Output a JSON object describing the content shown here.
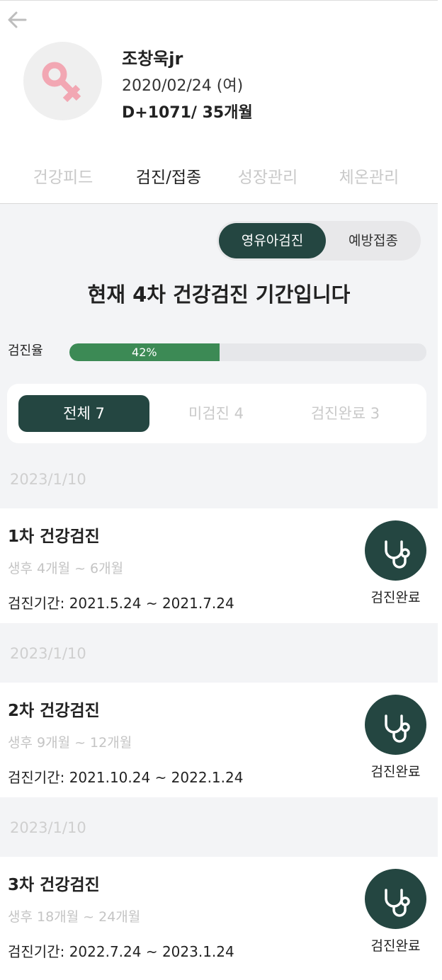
{
  "profile": {
    "name": "조창욱jr",
    "birth": "2020/02/24 (여)",
    "dday": "D+1071/ 35개월",
    "avatar_icon": "female-symbol-icon",
    "avatar_color": "#f2a7b3"
  },
  "tabs": [
    {
      "label": "건강피드",
      "active": false
    },
    {
      "label": "검진/접종",
      "active": true
    },
    {
      "label": "성장관리",
      "active": false
    },
    {
      "label": "체온관리",
      "active": false
    }
  ],
  "segment": {
    "options": [
      "영유아검진",
      "예방접종"
    ],
    "selected": "영유아검진"
  },
  "period_title": "현재 4차 건강검진 기간입니다",
  "rate": {
    "label": "검진율",
    "text": "42%",
    "value": 0.42
  },
  "filters": [
    {
      "label": "전체 7",
      "active": true
    },
    {
      "label": "미검진 4",
      "active": false
    },
    {
      "label": "검진완료 3",
      "active": false
    }
  ],
  "items": [
    {
      "date": "2023/1/10",
      "title": "1차 건강검진",
      "age": "생후 4개월 ~ 6개월",
      "period": "검진기간: 2021.5.24 ~ 2021.7.24",
      "status": "검진완료",
      "icon": "stethoscope-icon"
    },
    {
      "date": "2023/1/10",
      "title": "2차 건강검진",
      "age": "생후 9개월 ~ 12개월",
      "period": "검진기간: 2021.10.24 ~ 2022.1.24",
      "status": "검진완료",
      "icon": "stethoscope-icon"
    },
    {
      "date": "2023/1/10",
      "title": "3차 건강검진",
      "age": "생후 18개월 ~ 24개월",
      "period": "검진기간: 2022.7.24 ~ 2023.1.24",
      "status": "검진완료",
      "icon": "stethoscope-icon"
    }
  ],
  "colors": {
    "accent": "#244641",
    "progress": "#3c8a55",
    "background": "#f3f4f6"
  }
}
